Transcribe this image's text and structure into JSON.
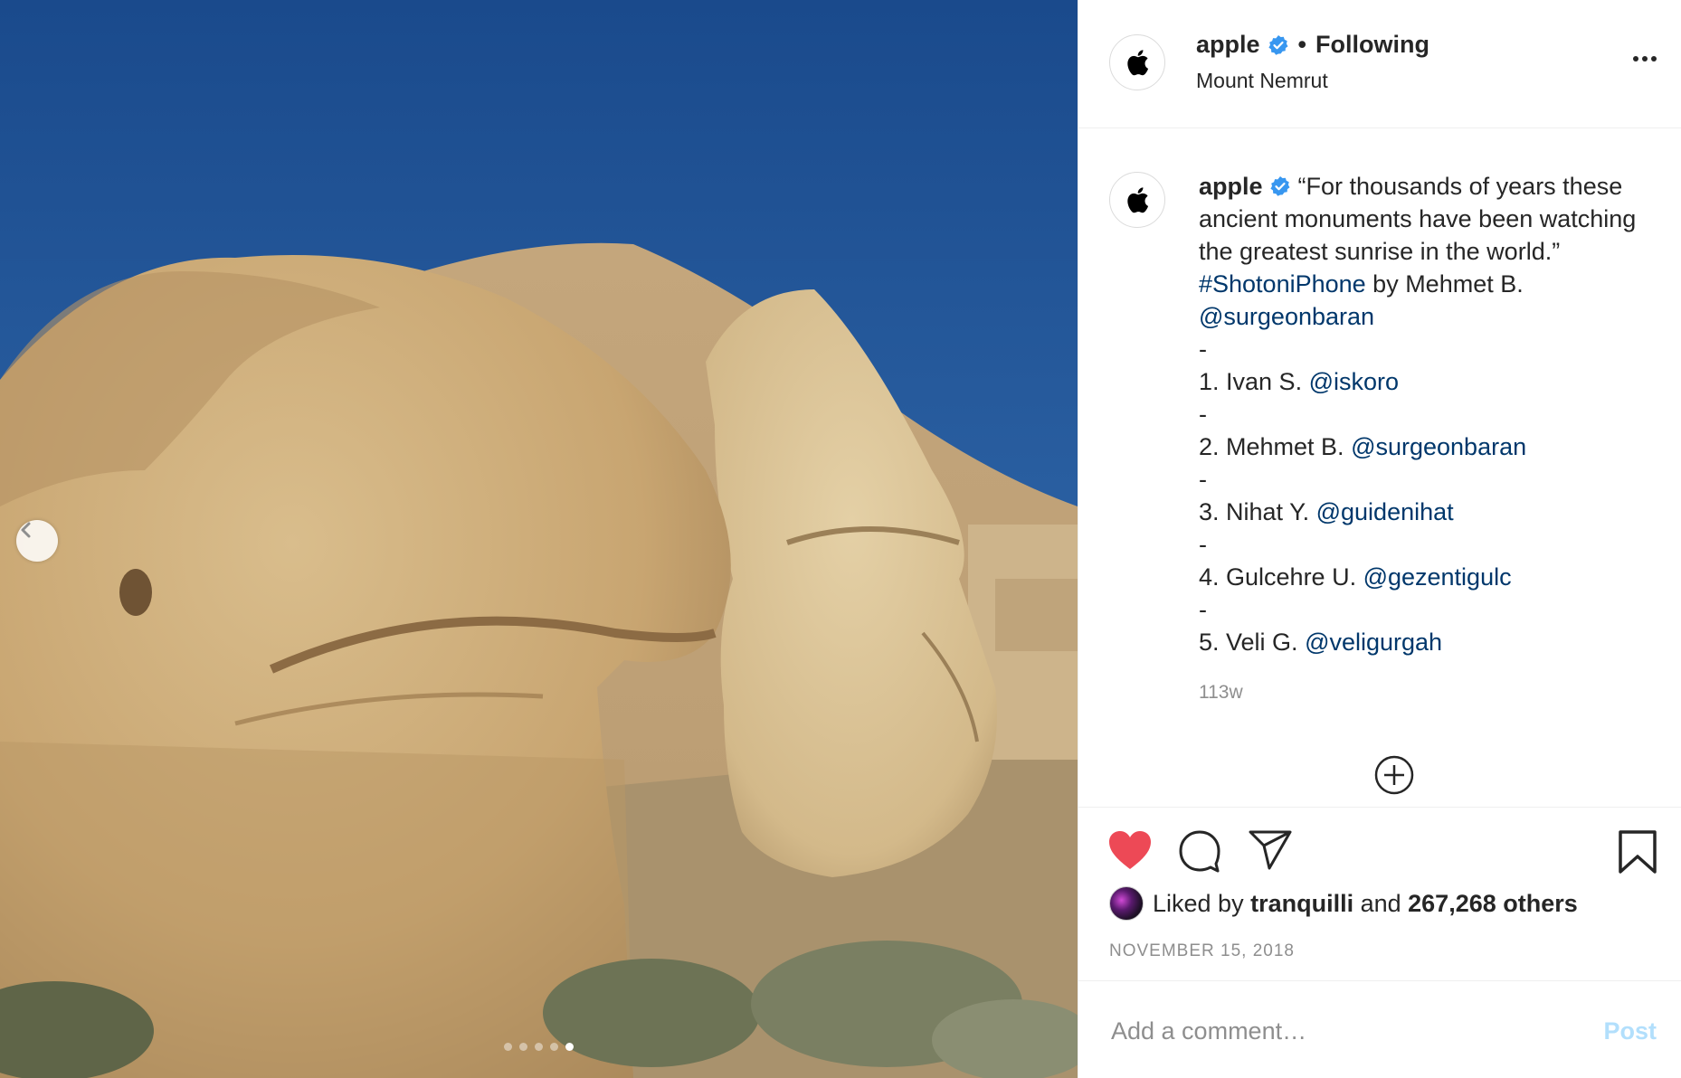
{
  "photo": {
    "alt_icon": "stone-heads-photo",
    "nav_prev_icon": "chevron-left-icon",
    "carousel": {
      "count": 5,
      "active_index": 4
    }
  },
  "header": {
    "username": "apple",
    "verified_icon": "verified-badge-icon",
    "separator": "•",
    "follow_status": "Following",
    "location": "Mount Nemrut",
    "more_icon": "more-options-icon"
  },
  "caption": {
    "username": "apple",
    "text_1": " “For thousands of years these ancient monuments have been watching the greatest sunrise in the world.” ",
    "hashtag": "#ShotoniPhone",
    "text_2": " by Mehmet B. ",
    "mention_0": "@surgeonbaran",
    "dash": "-",
    "credits": [
      {
        "label": "1. Ivan S. ",
        "handle": "@iskoro"
      },
      {
        "label": "2. Mehmet B. ",
        "handle": "@surgeonbaran"
      },
      {
        "label": "3. Nihat Y. ",
        "handle": "@guidenihat"
      },
      {
        "label": "4. Gulcehre U. ",
        "handle": "@gezentigulc"
      },
      {
        "label": "5. Veli G. ",
        "handle": "@veligurgah"
      }
    ],
    "time_ago": "113w"
  },
  "actions": {
    "like_icon": "heart-filled-icon",
    "comment_icon": "comment-icon",
    "share_icon": "share-icon",
    "save_icon": "bookmark-icon",
    "like_color": "#ed4956",
    "liked_by_prefix": "Liked by ",
    "liked_by_user": "tranquilli",
    "liked_by_and": " and ",
    "liked_by_count": "267,268 others",
    "date": "NOVEMBER 15, 2018"
  },
  "comment_box": {
    "placeholder": "Add a comment…",
    "post_label": "Post"
  }
}
